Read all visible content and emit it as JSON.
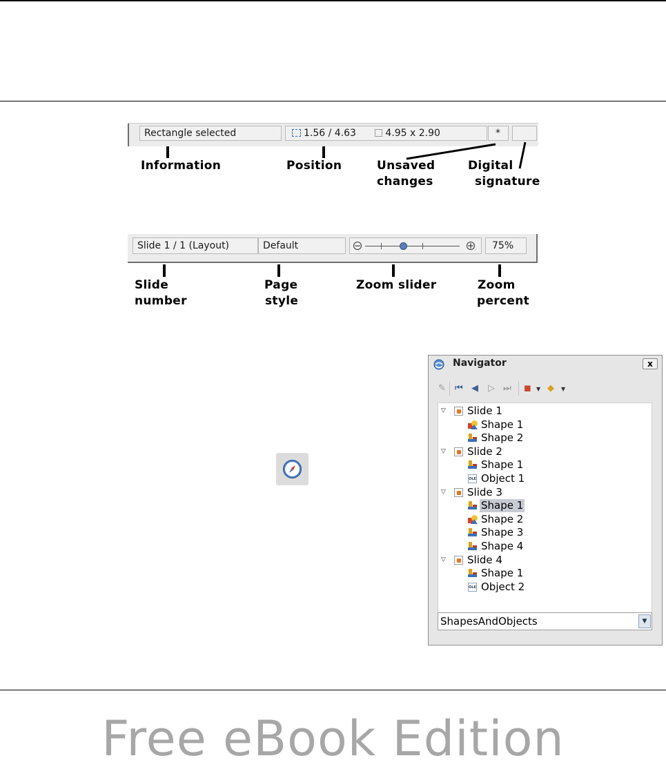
{
  "statusbar_top": {
    "information": "Rectangle selected",
    "position": "1.56 / 4.63",
    "size": "4.95 x 2.90",
    "unsaved": "*",
    "signature": ""
  },
  "callouts_top": {
    "information": "Information",
    "position": "Position",
    "unsaved_1": "Unsaved",
    "unsaved_2": "changes",
    "digital_1": "Digital",
    "digital_2": "signature"
  },
  "statusbar_bottom": {
    "slide": "Slide 1 / 1 (Layout)",
    "page_style": "Default",
    "zoom_minus": "−",
    "zoom_plus": "+",
    "zoom_percent": "75%"
  },
  "callouts_bottom": {
    "slide_1": "Slide",
    "slide_2": "number",
    "page_1": "Page",
    "page_2": "style",
    "zoom_slider": "Zoom slider",
    "zoom_pct_1": "Zoom",
    "zoom_pct_2": "percent"
  },
  "navigator": {
    "title": "Navigator",
    "close": "x",
    "tree": [
      {
        "label": "Slide 1",
        "type": "slide"
      },
      {
        "label": "Shape 1",
        "type": "shapes"
      },
      {
        "label": "Shape 2",
        "type": "shape"
      },
      {
        "label": "Slide 2",
        "type": "slide"
      },
      {
        "label": "Shape 1",
        "type": "shape"
      },
      {
        "label": "Object 1",
        "type": "ole"
      },
      {
        "label": "Slide 3",
        "type": "slide"
      },
      {
        "label": "Shape 1",
        "type": "shape",
        "selected": true
      },
      {
        "label": "Shape 2",
        "type": "shapes"
      },
      {
        "label": "Shape 3",
        "type": "shape"
      },
      {
        "label": "Shape 4",
        "type": "shape"
      },
      {
        "label": "Slide 4",
        "type": "slide"
      },
      {
        "label": "Shape 1",
        "type": "shape"
      },
      {
        "label": "Object 2",
        "type": "ole"
      }
    ],
    "combo_value": "ShapesAndObjects"
  },
  "watermark": "Free eBook Edition",
  "colors": {
    "slider_knob": "#5b7fb8",
    "selection": "#c7cbd4",
    "watermark": "#a7a7a7"
  }
}
